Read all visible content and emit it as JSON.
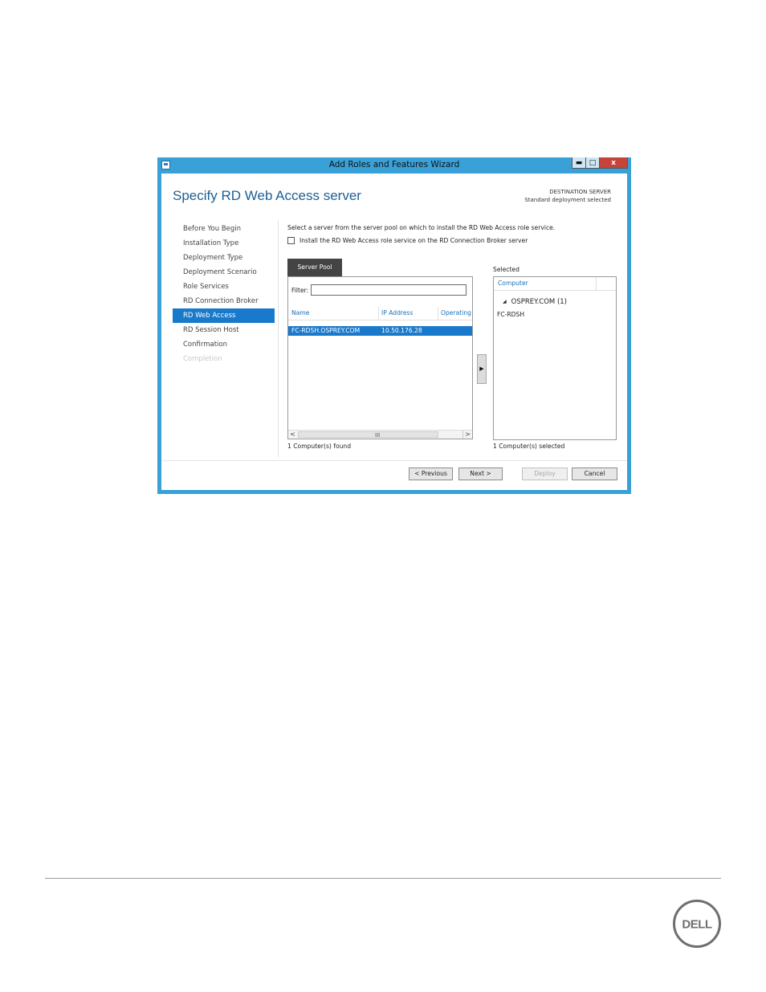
{
  "window": {
    "title": "Add Roles and Features Wizard",
    "min_glyph": "▬",
    "max_glyph": "□",
    "close_glyph": "x"
  },
  "page": {
    "title": "Specify RD Web Access server",
    "destination_label": "DESTINATION SERVER",
    "destination_value": "Standard deployment selected"
  },
  "nav": {
    "items": [
      {
        "label": "Before You Begin",
        "state": "normal"
      },
      {
        "label": "Installation Type",
        "state": "normal"
      },
      {
        "label": "Deployment Type",
        "state": "normal"
      },
      {
        "label": "Deployment Scenario",
        "state": "normal"
      },
      {
        "label": "Role Services",
        "state": "normal"
      },
      {
        "label": "RD Connection Broker",
        "state": "normal"
      },
      {
        "label": "RD Web Access",
        "state": "active"
      },
      {
        "label": "RD Session Host",
        "state": "normal"
      },
      {
        "label": "Confirmation",
        "state": "normal"
      },
      {
        "label": "Completion",
        "state": "disabled"
      }
    ]
  },
  "main": {
    "description": "Select a server from the server pool on which to install the RD Web Access role service.",
    "checkbox_label": "Install the RD Web Access role service on the RD Connection Broker server",
    "checkbox_checked": false,
    "tab_label": "Server Pool",
    "filter_label": "Filter:",
    "filter_value": "",
    "columns": [
      "Name",
      "IP Address",
      "Operating"
    ],
    "rows": [
      {
        "name": "FC-RDSH.OSPREY.COM",
        "ip": "10.50.176.28",
        "selected": true
      }
    ],
    "scroll_grip": "III",
    "scroll_left": "<",
    "scroll_right": ">",
    "found_text": "1 Computer(s) found",
    "add_arrow": "▶"
  },
  "selected": {
    "label": "Selected",
    "column": "Computer",
    "group_label": "OSPREY.COM (1)",
    "group_glyph": "◢",
    "items": [
      "FC-RDSH"
    ],
    "count_text": "1 Computer(s) selected"
  },
  "buttons": {
    "previous": "< Previous",
    "next": "Next >",
    "deploy": "Deploy",
    "cancel": "Cancel"
  },
  "colors": {
    "window_frame": "#3aa1d8",
    "accent": "#1979ca",
    "title_blue": "#1c5f94"
  },
  "logo": "DELL"
}
